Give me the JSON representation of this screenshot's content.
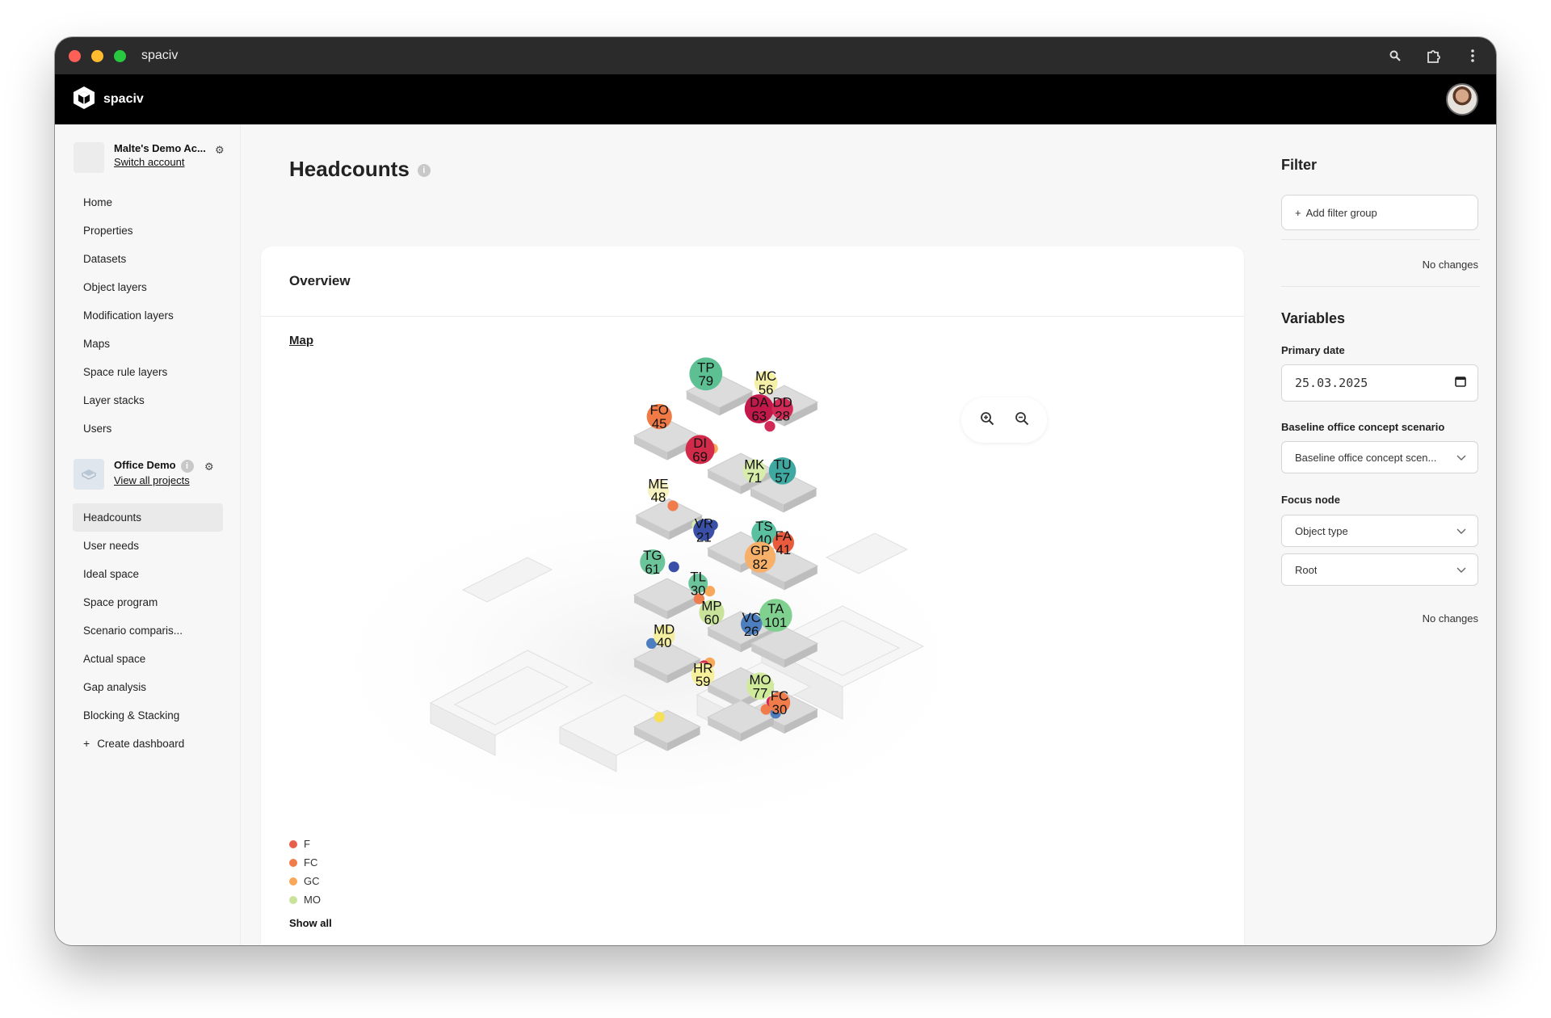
{
  "window": {
    "title": "spaciv"
  },
  "appbar": {
    "brand": "spaciv",
    "avatar_icon": "user-avatar"
  },
  "account": {
    "name": "Malte's Demo Ac...",
    "switch_label": "Switch account"
  },
  "nav_main": [
    {
      "label": "Home"
    },
    {
      "label": "Properties"
    },
    {
      "label": "Datasets"
    },
    {
      "label": "Object layers"
    },
    {
      "label": "Modification layers"
    },
    {
      "label": "Maps"
    },
    {
      "label": "Space rule layers"
    },
    {
      "label": "Layer stacks"
    },
    {
      "label": "Users"
    }
  ],
  "project": {
    "name": "Office Demo",
    "view_all_label": "View all projects"
  },
  "nav_project": [
    {
      "label": "Headcounts",
      "active": true
    },
    {
      "label": "User needs"
    },
    {
      "label": "Ideal space"
    },
    {
      "label": "Space program"
    },
    {
      "label": "Scenario comparis..."
    },
    {
      "label": "Actual space"
    },
    {
      "label": "Gap analysis"
    },
    {
      "label": "Blocking & Stacking"
    }
  ],
  "create_dashboard_label": "Create dashboard",
  "page": {
    "title": "Headcounts"
  },
  "card": {
    "title": "Overview",
    "map_tab": "Map",
    "show_all": "Show all"
  },
  "legend": [
    {
      "label": "F",
      "color": "#e8604c"
    },
    {
      "label": "FC",
      "color": "#f07c4c"
    },
    {
      "label": "GC",
      "color": "#f7a85a"
    },
    {
      "label": "MO",
      "color": "#c9e49a"
    }
  ],
  "map_bubbles": [
    {
      "code": "TP",
      "value": "79",
      "color": "#5cc093"
    },
    {
      "code": "MC",
      "value": "56",
      "color": "#f4f0a8"
    },
    {
      "code": "DA",
      "value": "63",
      "color": "#c2184a"
    },
    {
      "code": "DD",
      "value": "28",
      "color": "#d22a56"
    },
    {
      "code": "FO",
      "value": "45",
      "color": "#f07a45"
    },
    {
      "code": "DI",
      "value": "69",
      "color": "#d22a49"
    },
    {
      "code": "MK",
      "value": "71",
      "color": "#d8edab"
    },
    {
      "code": "TU",
      "value": "57",
      "color": "#3fa8a0"
    },
    {
      "code": "ME",
      "value": "48",
      "color": "#f7f3c0"
    },
    {
      "code": "VR",
      "value": "21",
      "color": "#3a4fa8"
    },
    {
      "code": "TS",
      "value": "40",
      "color": "#5bc0a0"
    },
    {
      "code": "FA",
      "value": "41",
      "color": "#ea5a3c"
    },
    {
      "code": "GP",
      "value": "82",
      "color": "#f7b06a"
    },
    {
      "code": "TG",
      "value": "61",
      "color": "#6cc49a"
    },
    {
      "code": "TL",
      "value": "30",
      "color": "#6cc49a"
    },
    {
      "code": "MP",
      "value": "60",
      "color": "#c9e49a"
    },
    {
      "code": "TA",
      "value": "101",
      "color": "#80d090"
    },
    {
      "code": "VC",
      "value": "26",
      "color": "#4d7fc0"
    },
    {
      "code": "MD",
      "value": "40",
      "color": "#f4eea0"
    },
    {
      "code": "HR",
      "value": "59",
      "color": "#f6ef9c"
    },
    {
      "code": "MO",
      "value": "77",
      "color": "#d0ea9c"
    },
    {
      "code": "FC",
      "value": "30",
      "color": "#f07c4c"
    }
  ],
  "filter": {
    "title": "Filter",
    "add_group_label": "Add filter group",
    "status": "No changes"
  },
  "variables": {
    "title": "Variables",
    "primary_date_label": "Primary date",
    "primary_date_value": "25.03.2025",
    "scenario_label": "Baseline office concept scenario",
    "scenario_value": "Baseline office concept scen...",
    "focus_label": "Focus node",
    "focus_type_value": "Object type",
    "focus_root_value": "Root",
    "status": "No changes"
  }
}
